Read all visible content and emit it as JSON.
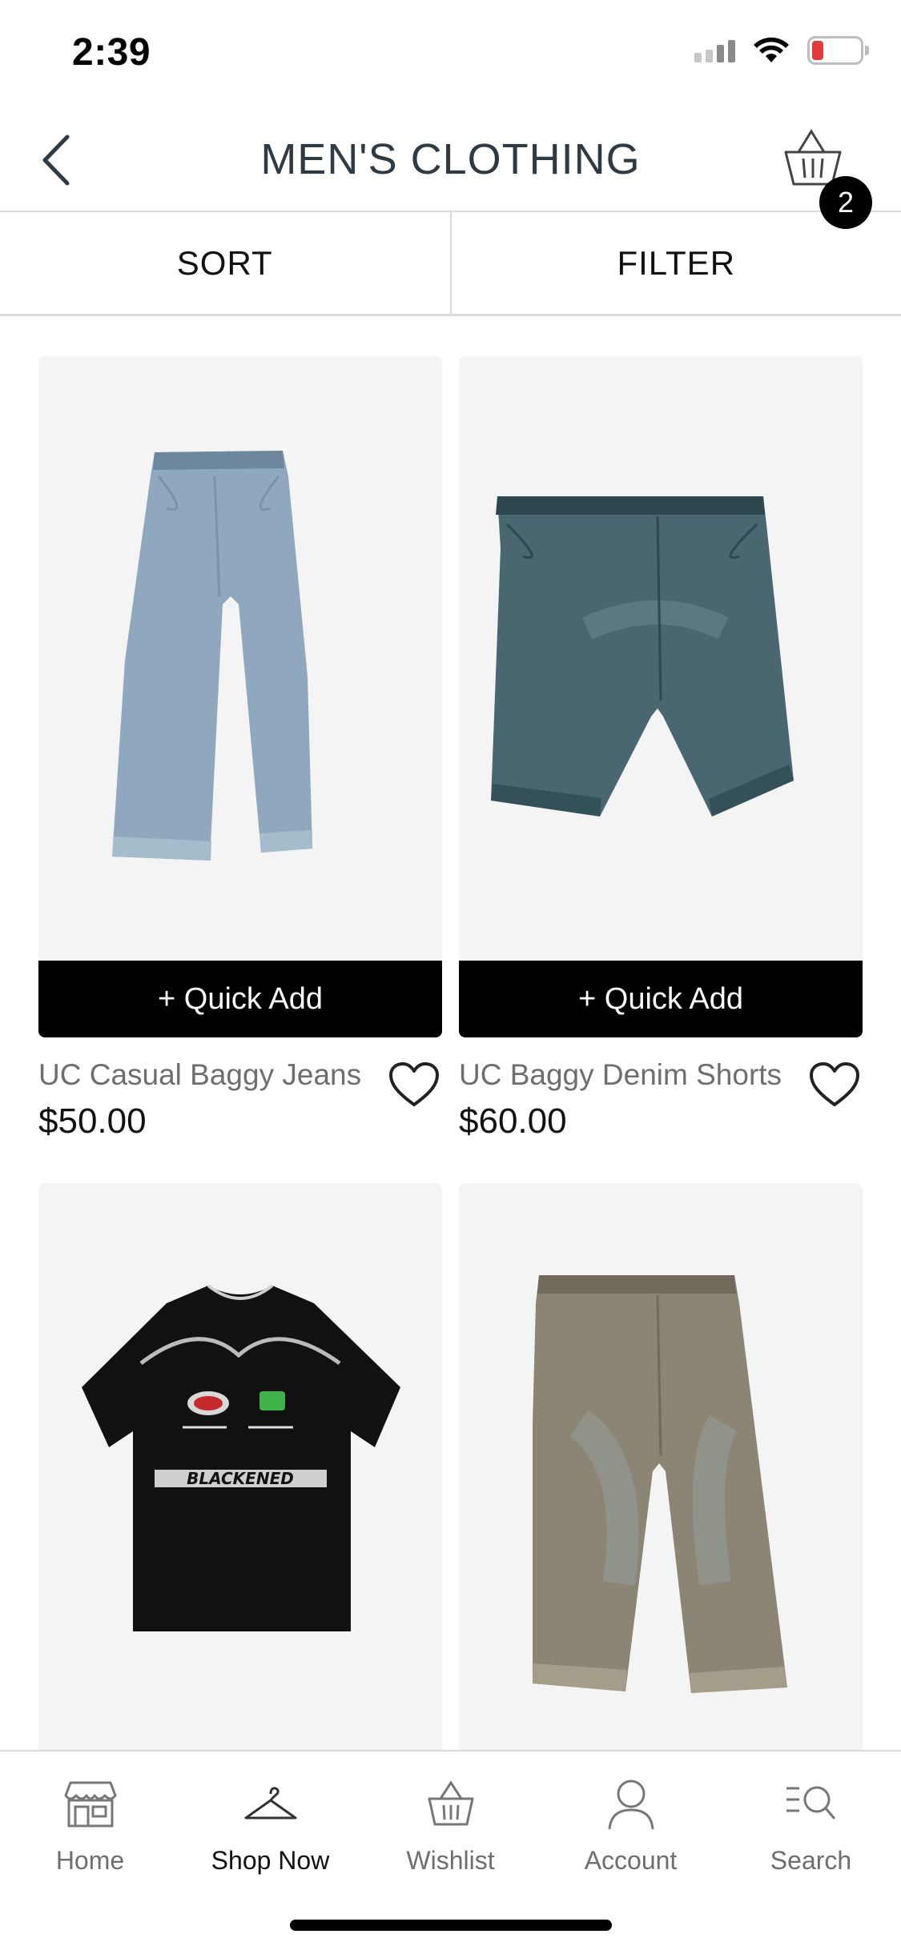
{
  "status_bar": {
    "time": "2:39",
    "battery": "11",
    "battery_color": "#e33b3b"
  },
  "header": {
    "title": "MEN'S CLOTHING",
    "back_icon": "chevron-left-icon",
    "cart_icon": "basket-icon",
    "cart_count": "2"
  },
  "controls": {
    "sort_label": "SORT",
    "filter_label": "FILTER"
  },
  "products": [
    {
      "name": "UC Casual Baggy Jeans",
      "price": "$50.00",
      "quick_add": "+ Quick Add",
      "image": "light-wash-baggy-jeans"
    },
    {
      "name": "UC Baggy Denim Shorts",
      "price": "$60.00",
      "quick_add": "+ Quick Add",
      "image": "dark-wash-denim-shorts"
    },
    {
      "name": "",
      "price": "",
      "image": "black-graphic-tshirt",
      "graphic_text": "BLACKENED"
    },
    {
      "name": "",
      "price": "",
      "image": "vintage-wash-wide-jeans"
    }
  ],
  "bottom_nav": {
    "items": [
      {
        "label": "Home",
        "icon": "storefront-icon",
        "active": false
      },
      {
        "label": "Shop Now",
        "icon": "hanger-icon",
        "active": true
      },
      {
        "label": "Wishlist",
        "icon": "basket-icon",
        "active": false
      },
      {
        "label": "Account",
        "icon": "person-icon",
        "active": false
      },
      {
        "label": "Search",
        "icon": "search-list-icon",
        "active": false
      }
    ]
  },
  "colors": {
    "accent": "#000000",
    "title_text": "#2e3a44",
    "muted_text": "#6e6e6e",
    "image_bg": "#f4f4f4"
  }
}
